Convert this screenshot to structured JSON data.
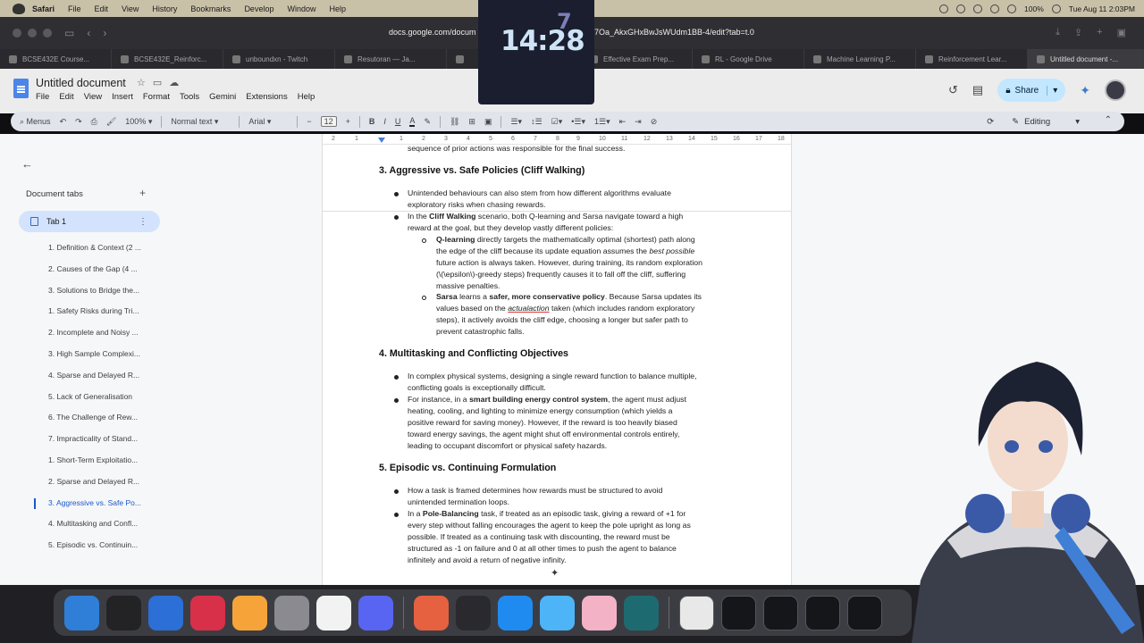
{
  "menubar": {
    "app": "Safari",
    "items": [
      "File",
      "Edit",
      "View",
      "History",
      "Bookmarks",
      "Develop",
      "Window",
      "Help"
    ],
    "battery": "100%",
    "datetime": "Tue Aug 11  2:03PM"
  },
  "browser": {
    "url_left": "docs.google.com/docum",
    "url_right": "7Oa_AkxGHxBwJsWUdm1BB-4/edit?tab=t.0",
    "tabs": [
      "BCSE432E Course...",
      "BCSE432E_Reinforc...",
      "unboundxn - Twitch",
      "Resutoran — Ja...",
      "",
      "Effective Exam Prep...",
      "RL - Google Drive",
      "Machine Learning P...",
      "Reinforcement Lear...",
      "Untitled document -..."
    ]
  },
  "clock": {
    "main": "14:28",
    "ghost": "7"
  },
  "docs": {
    "title": "Untitled document",
    "menu": [
      "File",
      "Edit",
      "View",
      "Insert",
      "Format",
      "Tools",
      "Gemini",
      "Extensions",
      "Help"
    ],
    "share_label": "Share",
    "toolbar": {
      "search": "Menus",
      "zoom": "100%",
      "style": "Normal text",
      "font": "Arial",
      "size": "12",
      "mode": "Editing"
    },
    "sidebar": {
      "header": "Document tabs",
      "tab1": "Tab 1",
      "outline": [
        "1. Definition & Context (2 ...",
        "2. Causes of the Gap (4 ...",
        "3. Solutions to Bridge the...",
        "1. Safety Risks during Tri...",
        "2. Incomplete and Noisy ...",
        "3. High Sample Complexi...",
        "4. Sparse and Delayed R...",
        "5. Lack of Generalisation",
        "6. The Challenge of Rew...",
        "7. Impracticality of Stand...",
        "1. Short-Term Exploitatio...",
        "2. Sparse and Delayed R...",
        "3. Aggressive vs. Safe Po...",
        "4. Multitasking and Confl...",
        "5. Episodic vs. Continuin..."
      ]
    },
    "ruler": [
      "2",
      "1",
      "1",
      "2",
      "3",
      "4",
      "5",
      "6",
      "7",
      "8",
      "9",
      "10",
      "11",
      "12",
      "13",
      "14",
      "15",
      "16",
      "17",
      "18"
    ],
    "body": {
      "top_cut": "sequence of prior actions was responsible for the final success.",
      "h3": "3. Aggressive vs. Safe Policies (Cliff Walking)",
      "s3_b1_l1": "Unintended behaviours can also stem from how different algorithms evaluate",
      "s3_b1_l2": "exploratory risks when chasing rewards.",
      "s3_b2_pre": "In the ",
      "s3_b2_bold": "Cliff Walking",
      "s3_b2_l1rest": " scenario, both Q-learning and Sarsa navigate toward a high",
      "s3_b2_l2": "reward at the goal, but they develop vastly different policies:",
      "q_bold": "Q-learning",
      "q_l1rest": " directly targets the mathematically optimal (shortest) path along",
      "q_l2_pre": "the edge of the cliff because its update equation assumes the ",
      "q_l2_ital": "best possible",
      "q_l3": "future action is always taken. However, during training, its random exploration",
      "q_l4": "(\\(\\epsilon\\)-greedy steps) frequently causes it to fall off the cliff, suffering",
      "q_l5": "massive penalties.",
      "sa_bold": "Sarsa",
      "sa_l1_mid": " learns a ",
      "sa_l1_bold2": "safer, more conservative policy",
      "sa_l1_rest": ". Because Sarsa updates its",
      "sa_l2_pre": "values based on the ",
      "sa_l2_ital": "actualaction",
      "sa_l2_rest": " taken (which includes random exploratory",
      "sa_l3": "steps), it actively avoids the cliff edge, choosing a longer but safer path to",
      "sa_l4": "prevent catastrophic falls.",
      "h4": "4. Multitasking and Conflicting Objectives",
      "s4_b1_l1": "In complex physical systems, designing a single reward function to balance multiple,",
      "s4_b1_l2": "conflicting goals is exceptionally difficult.",
      "s4_b2_pre": "For instance, in a ",
      "s4_b2_bold": "smart building energy control system",
      "s4_b2_l1rest": ", the agent must adjust",
      "s4_b2_l2": "heating, cooling, and lighting to minimize energy consumption (which yields a",
      "s4_b2_l3": "positive reward for saving money). However, if the reward is too heavily biased",
      "s4_b2_l4": "toward energy savings, the agent might shut off environmental controls entirely,",
      "s4_b2_l5": "leading to occupant discomfort or physical safety hazards.",
      "h5": "5. Episodic vs. Continuing Formulation",
      "s5_b1_l1": "How a task is framed determines how rewards must be structured to avoid",
      "s5_b1_l2": "unintended termination loops.",
      "s5_b2_pre": "In a ",
      "s5_b2_bold": "Pole-Balancing",
      "s5_b2_l1rest": " task, if treated as an episodic task, giving a reward of +1 for",
      "s5_b2_l2": "every step without falling encourages the agent to keep the pole upright as long as",
      "s5_b2_l3": "possible. If treated as a continuing task with discounting, the reward must be",
      "s5_b2_l4": "structured as -1 on failure and 0 at all other times to push the agent to balance",
      "s5_b2_l5": "infinitely and avoid a return of negative infinity."
    }
  },
  "dock": {
    "colors": [
      "#2f7fd8",
      "#232326",
      "#2c6fd6",
      "#d9304a",
      "#f6a43a",
      "#8a8a90",
      "#f2f2f2",
      "#5865f2",
      "#e6613f",
      "#2a2a2e",
      "#1f8bf0",
      "#4db4f7",
      "#f3b2c6",
      "#1d6b70"
    ],
    "labels": [
      "Finder",
      "Launchpad",
      "Mail",
      "Music",
      "Pages",
      "System Settings",
      "Freeform",
      "Discord",
      "Stickies",
      "OBS",
      "Safari",
      "Xcode",
      "Photo Booth",
      "Script Editor"
    ]
  }
}
